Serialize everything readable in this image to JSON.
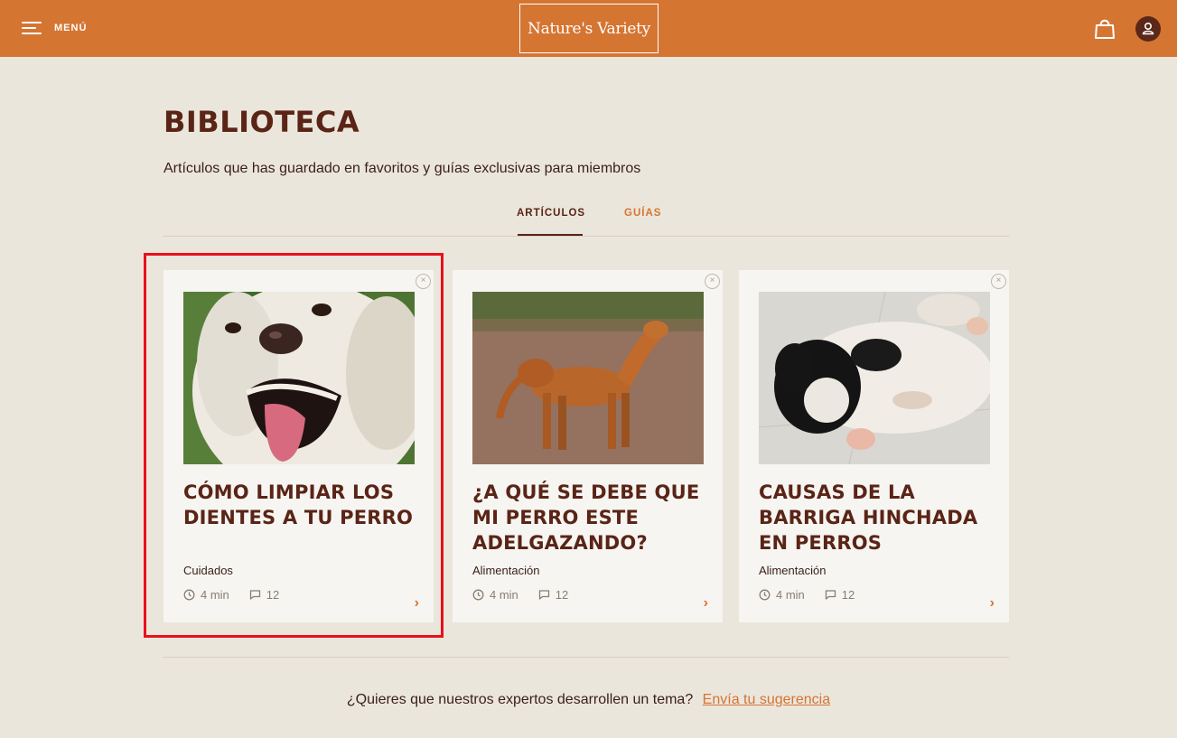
{
  "header": {
    "menu_label": "MENÚ",
    "logo_text": "Nature's Variety",
    "brand_color": "#d57532"
  },
  "page": {
    "title": "BIBLIOTECA",
    "subtitle": "Artículos que has guardado en favoritos y guías exclusivas para miembros"
  },
  "tabs": [
    {
      "label": "ARTÍCULOS",
      "active": true
    },
    {
      "label": "GUÍAS",
      "active": false
    }
  ],
  "cards": [
    {
      "title": "CÓMO LIMPIAR LOS DIENTES A TU PERRO",
      "category": "Cuidados",
      "read_time": "4 min",
      "comments": "12",
      "image": "golden-retriever-closeup",
      "highlighted": true
    },
    {
      "title": "¿A QUÉ SE DEBE QUE MI PERRO ESTE ADELGAZANDO?",
      "category": "Alimentación",
      "read_time": "4 min",
      "comments": "12",
      "image": "golden-retriever-standing"
    },
    {
      "title": "CAUSAS DE LA BARRIGA HINCHADA EN PERROS",
      "category": "Alimentación",
      "read_time": "4 min",
      "comments": "12",
      "image": "border-collie-lying"
    }
  ],
  "footer": {
    "prompt": "¿Quieres que nuestros expertos desarrollen un tema?",
    "link": "Envía tu sugerencia"
  },
  "icons": [
    "menu-icon",
    "bag-icon",
    "user-icon",
    "close-icon",
    "clock-icon",
    "comment-icon",
    "chevron-right-icon"
  ]
}
